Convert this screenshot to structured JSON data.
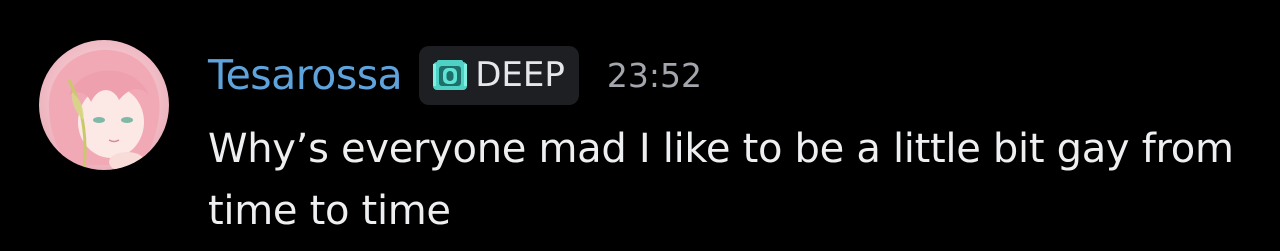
{
  "message": {
    "author": {
      "name": "Tesarossa",
      "name_color": "#5fa3dc",
      "avatar": "avatar-image"
    },
    "guild_tag": {
      "icon": "shield-icon",
      "icon_color": "#4fd1c5",
      "label": "DEEP"
    },
    "timestamp": "23:52",
    "content": "Why’s everyone mad I like to be a little bit gay from time to time"
  }
}
